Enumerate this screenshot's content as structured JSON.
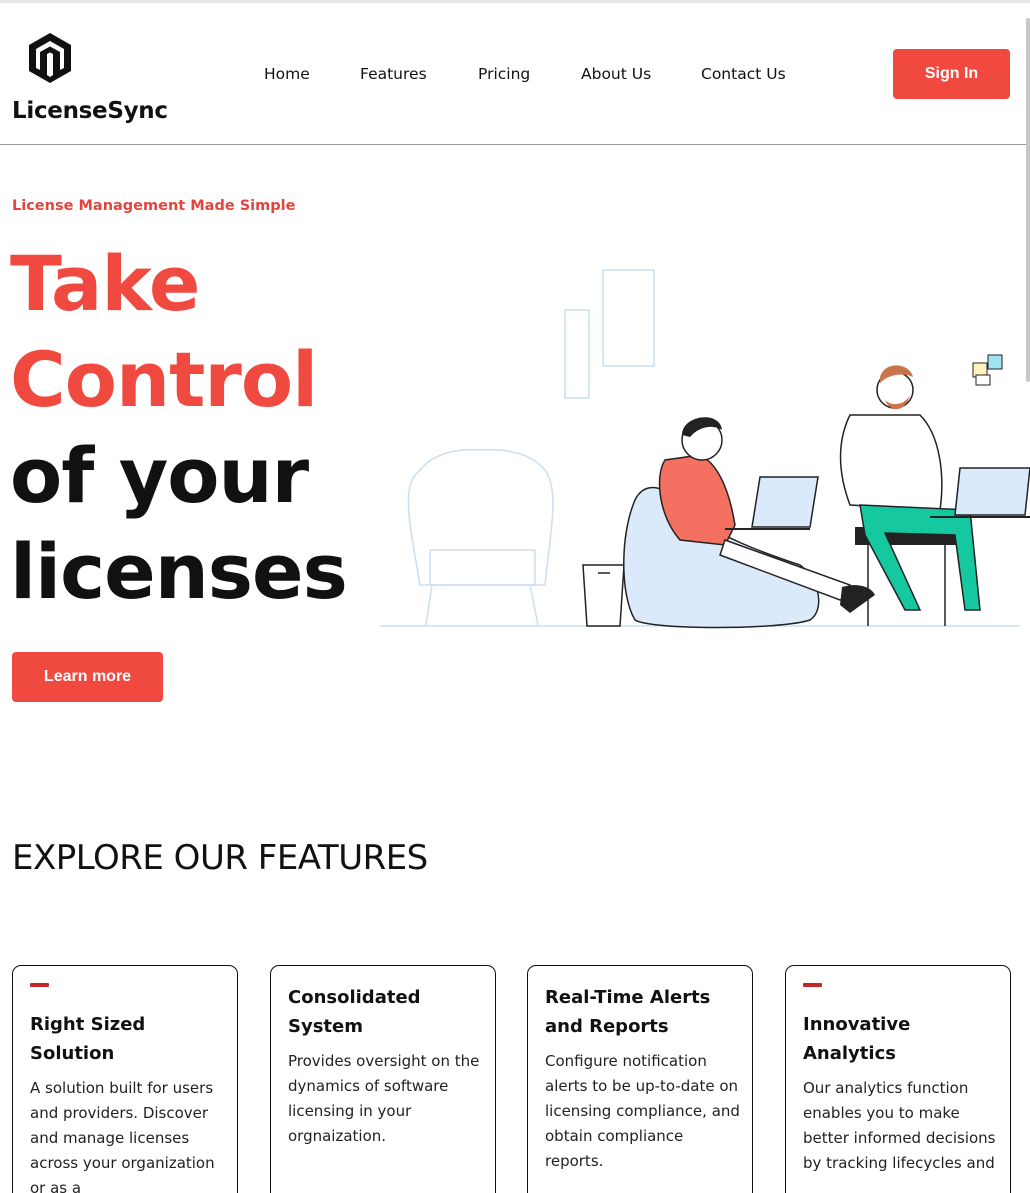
{
  "header": {
    "brand": "LicenseSync",
    "nav": [
      "Home",
      "Features",
      "Pricing",
      "About Us",
      "Contact Us"
    ],
    "signin_label": "Sign In"
  },
  "hero": {
    "tagline": "License Management Made Simple",
    "line1": "Take",
    "line2": "Control",
    "line3": "of your",
    "line4": "licenses",
    "cta_label": "Learn more"
  },
  "features": {
    "title": "EXPLORE OUR FEATURES",
    "cards": [
      {
        "title": "Right Sized Solution",
        "text": "A solution built for users and providers. Discover and manage licenses across your organization or as a"
      },
      {
        "title": "Consolidated System",
        "text": "Provides oversight on the dynamics of software licensing in your orgnaization."
      },
      {
        "title": "Real-Time Alerts and Reports",
        "text": "Configure notification alerts to be up-to-date on licensing compliance, and obtain compliance reports."
      },
      {
        "title": "Innovative Analytics",
        "text": "Our analytics function enables you to make better informed decisions by tracking lifecycles and"
      }
    ]
  },
  "colors": {
    "accent": "#f04a40",
    "text": "#111111",
    "bar": "#c62828"
  },
  "icons": [
    "hexagon-logo-icon"
  ]
}
